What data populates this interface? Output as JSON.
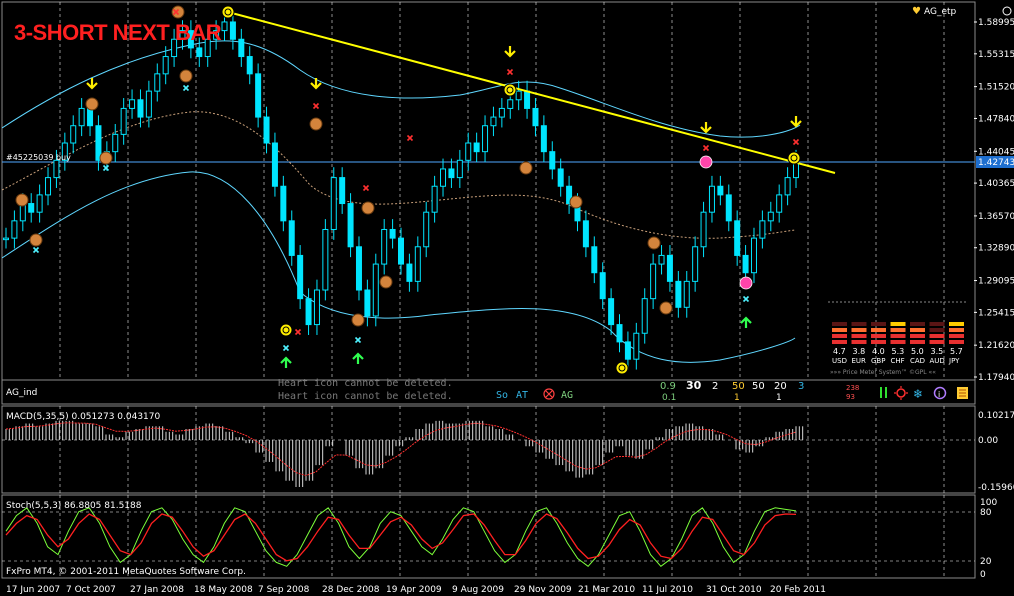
{
  "header": {
    "signal_text": "3-SHORT NEXT BAR",
    "indicator_name": "AG_etp"
  },
  "main_chart": {
    "trade_label": "#45225039 buy",
    "current_price": "1.42743",
    "price_ticks": [
      "1.58995",
      "1.55315",
      "1.51520",
      "1.47840",
      "1.44045",
      "1.40365",
      "1.36570",
      "1.32890",
      "1.29095",
      "1.25415",
      "1.21620",
      "1.17940"
    ],
    "currency_meter": {
      "values": [
        "4.7",
        "3.8",
        "4.0",
        "5.3",
        "5.0",
        "3.5",
        "5.7"
      ],
      "currencies": [
        "USD",
        "EUR",
        "GBP",
        "CHF",
        "CAD",
        "AUD",
        "JPY"
      ],
      "levels": [
        4.7,
        3.8,
        4.0,
        5.3,
        5.0,
        3.5,
        5.7
      ],
      "caption": "»»» Price Meter System™ ©GPL ««"
    }
  },
  "ag_strip": {
    "label": "AG_ind",
    "warning_line_1": "Heart icon cannot be deleted.",
    "warning_line_2": "Heart icon cannot be deleted.",
    "so_label": "So",
    "at_label": "AT",
    "ag_label": "AG",
    "readouts": [
      {
        "top": "0.9",
        "bottom": "0.1",
        "color": "#7fd07f"
      },
      {
        "top": "30",
        "bottom": "",
        "color": "#ffffff"
      },
      {
        "top": "2",
        "bottom": "",
        "color": "#ffffff"
      },
      {
        "top": "50",
        "bottom": "1",
        "color": "#ffcc33"
      },
      {
        "top": "50",
        "bottom": "",
        "color": "#ffffff"
      },
      {
        "top": "20",
        "bottom": "1",
        "color": "#ffffff"
      },
      {
        "top": "3",
        "bottom": "",
        "color": "#33b5e5"
      }
    ],
    "counter_top": "238",
    "counter_bottom": "93"
  },
  "macd": {
    "label": "MACD(5,35,5) 0.051273 0.043170",
    "ticks": [
      "0.10217",
      "0.00",
      "-0.15960"
    ]
  },
  "stoch": {
    "label": "Stoch(5,5,3) 86.8805 81.5188",
    "ticks": [
      "100",
      "80",
      "20",
      "0"
    ]
  },
  "footer": {
    "copyright": "FxPro MT4, © 2001-2011 MetaQuotes Software Corp.",
    "dates": [
      "17 Jun 2007",
      "7 Oct 2007",
      "27 Jan 2008",
      "18 May 2008",
      "7 Sep 2008",
      "28 Dec 2008",
      "19 Apr 2009",
      "9 Aug 2009",
      "29 Nov 2009",
      "21 Mar 2010",
      "11 Jul 2010",
      "31 Oct 2010",
      "20 Feb 2011"
    ]
  },
  "chart_data": {
    "type": "candlestick",
    "price_axis_range": [
      1.1794,
      1.58995
    ],
    "close_series": [
      1.34,
      1.36,
      1.38,
      1.37,
      1.39,
      1.41,
      1.43,
      1.45,
      1.47,
      1.49,
      1.47,
      1.43,
      1.44,
      1.46,
      1.49,
      1.5,
      1.48,
      1.51,
      1.53,
      1.55,
      1.57,
      1.58,
      1.56,
      1.55,
      1.57,
      1.58,
      1.59,
      1.57,
      1.55,
      1.53,
      1.48,
      1.45,
      1.4,
      1.36,
      1.32,
      1.27,
      1.24,
      1.28,
      1.35,
      1.41,
      1.38,
      1.33,
      1.28,
      1.25,
      1.31,
      1.35,
      1.34,
      1.31,
      1.29,
      1.33,
      1.37,
      1.4,
      1.42,
      1.41,
      1.43,
      1.45,
      1.44,
      1.47,
      1.48,
      1.49,
      1.5,
      1.51,
      1.49,
      1.47,
      1.44,
      1.42,
      1.4,
      1.38,
      1.36,
      1.33,
      1.3,
      1.27,
      1.24,
      1.22,
      1.2,
      1.23,
      1.27,
      1.31,
      1.32,
      1.29,
      1.26,
      1.29,
      1.33,
      1.37,
      1.4,
      1.39,
      1.36,
      1.32,
      1.3,
      1.34,
      1.36,
      1.37,
      1.39,
      1.41,
      1.43
    ],
    "macd_histogram": [
      0.04,
      0.05,
      0.06,
      0.05,
      0.06,
      0.07,
      0.07,
      0.06,
      0.06,
      0.05,
      0.02,
      0.01,
      0.03,
      0.04,
      0.05,
      0.05,
      0.03,
      0.02,
      0.04,
      0.05,
      0.06,
      0.05,
      0.03,
      0.01,
      -0.01,
      -0.04,
      -0.07,
      -0.1,
      -0.13,
      -0.15,
      -0.13,
      -0.08,
      -0.02,
      0.0,
      -0.05,
      -0.09,
      -0.11,
      -0.09,
      -0.05,
      -0.02,
      0.01,
      0.04,
      0.06,
      0.07,
      0.06,
      0.06,
      0.07,
      0.07,
      0.05,
      0.04,
      0.02,
      0.0,
      -0.02,
      -0.04,
      -0.06,
      -0.08,
      -0.1,
      -0.12,
      -0.11,
      -0.08,
      -0.04,
      -0.02,
      -0.05,
      -0.06,
      -0.03,
      0.01,
      0.04,
      0.05,
      0.06,
      0.05,
      0.04,
      0.02,
      0.0,
      -0.03,
      -0.04,
      -0.02,
      0.01,
      0.03,
      0.04,
      0.05
    ],
    "stoch_main": [
      60,
      80,
      90,
      70,
      40,
      30,
      60,
      85,
      90,
      70,
      40,
      20,
      30,
      60,
      85,
      90,
      75,
      50,
      30,
      20,
      40,
      70,
      90,
      85,
      60,
      35,
      20,
      15,
      30,
      55,
      80,
      90,
      70,
      40,
      25,
      40,
      70,
      85,
      80,
      60,
      40,
      30,
      50,
      75,
      90,
      85,
      60,
      35,
      20,
      30,
      60,
      85,
      90,
      70,
      45,
      25,
      15,
      30,
      55,
      80,
      85,
      60,
      30,
      15,
      25,
      50,
      80,
      90,
      70,
      40,
      20,
      30,
      60,
      85,
      90,
      88,
      86
    ],
    "stoch_signal": [
      55,
      70,
      80,
      75,
      55,
      40,
      50,
      70,
      82,
      75,
      55,
      35,
      30,
      45,
      70,
      82,
      78,
      60,
      40,
      28,
      35,
      55,
      75,
      82,
      70,
      50,
      30,
      22,
      25,
      40,
      60,
      78,
      75,
      55,
      38,
      38,
      55,
      72,
      78,
      68,
      50,
      38,
      45,
      62,
      80,
      82,
      68,
      48,
      30,
      30,
      48,
      70,
      82,
      76,
      58,
      38,
      25,
      28,
      42,
      62,
      75,
      68,
      45,
      28,
      25,
      38,
      60,
      78,
      75,
      55,
      35,
      30,
      45,
      68,
      80,
      82,
      81.5
    ]
  }
}
